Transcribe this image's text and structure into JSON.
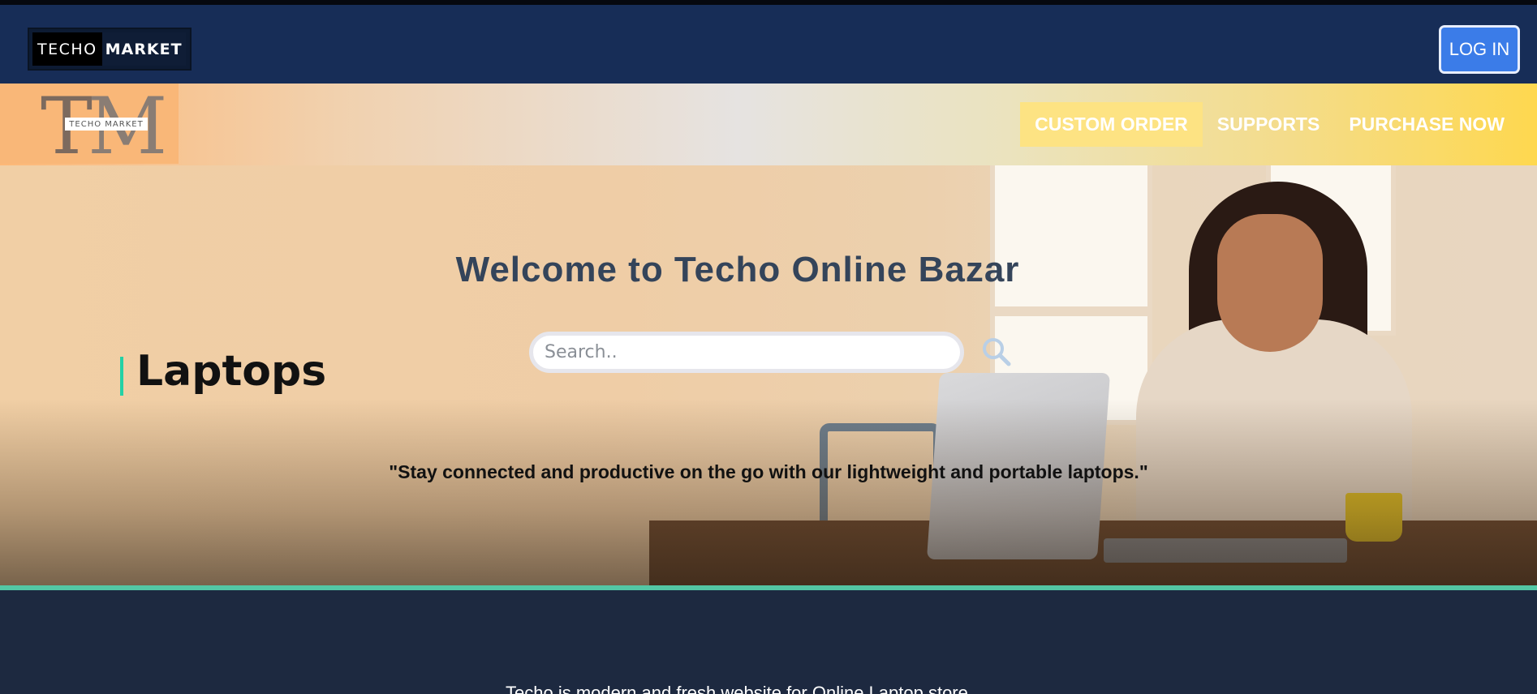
{
  "header": {
    "brand_left": "TECHO",
    "brand_right": "MARKET",
    "login_label": "LOG IN"
  },
  "navband": {
    "logo_letters_t": "T",
    "logo_letters_m": "M",
    "logo_plate": "TECHO MARKET",
    "nav_items": [
      {
        "label": "CUSTOM ORDER",
        "active": true
      },
      {
        "label": "SUPPORTS",
        "active": false
      },
      {
        "label": "PURCHASE NOW",
        "active": false
      }
    ]
  },
  "hero": {
    "title": "Welcome to Techo Online Bazar",
    "search": {
      "placeholder": "Search..",
      "value": ""
    },
    "category_label": "Laptops",
    "tagline": "\"Stay connected and productive on the go with our lightweight and portable laptops.\""
  },
  "footer": {
    "text": "Techo is modern and fresh website for Online Laptop store."
  },
  "colors": {
    "topbar": "#172d57",
    "login_button": "#3b7ce8",
    "accent_line": "#53c7a5",
    "category_marker": "#24d1a5",
    "footer_bg": "#1d2940"
  },
  "icons": {
    "search": "search-icon"
  }
}
